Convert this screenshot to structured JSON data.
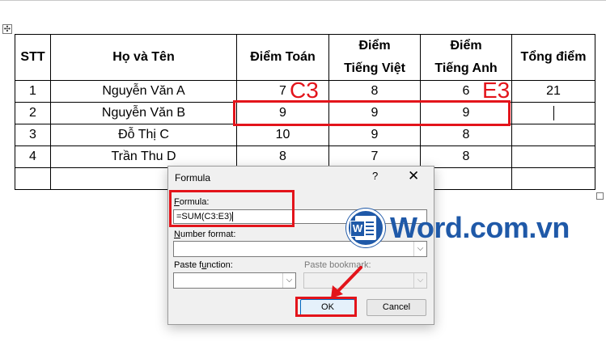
{
  "table": {
    "headers": [
      "STT",
      "Họ và Tên",
      "Điểm Toán",
      "Điểm",
      "Tiếng Việt",
      "Điểm",
      "Tiếng Anh",
      "Tổng điểm"
    ],
    "rows": [
      [
        "1",
        "Nguyễn Văn A",
        "7",
        "8",
        "6",
        "21"
      ],
      [
        "2",
        "Nguyễn Văn B",
        "9",
        "9",
        "9",
        ""
      ],
      [
        "3",
        "Đỗ Thị C",
        "10",
        "9",
        "8",
        ""
      ],
      [
        "4",
        "Trần Thu D",
        "8",
        "7",
        "8",
        ""
      ]
    ]
  },
  "annotations": {
    "c3": "C3",
    "e3": "E3",
    "color": "#e3141b"
  },
  "dialog": {
    "title": "Formula",
    "help": "?",
    "close": "✕",
    "formula_label_u": "F",
    "formula_label_rest": "ormula:",
    "formula_value": "=SUM(C3:E3)",
    "number_format_label_u": "N",
    "number_format_label_rest": "umber format:",
    "paste_function_label_pre": "Paste f",
    "paste_function_label_u": "u",
    "paste_function_label_rest": "nction:",
    "paste_bookmark_label": "Paste bookmark:",
    "ok": "OK",
    "cancel": "Cancel",
    "dropdown_arrow": "⌵"
  },
  "logo": {
    "letter": "W",
    "text": "Word.com.vn",
    "color": "#1f59a8"
  },
  "icons": {
    "move_handle": "✣"
  }
}
